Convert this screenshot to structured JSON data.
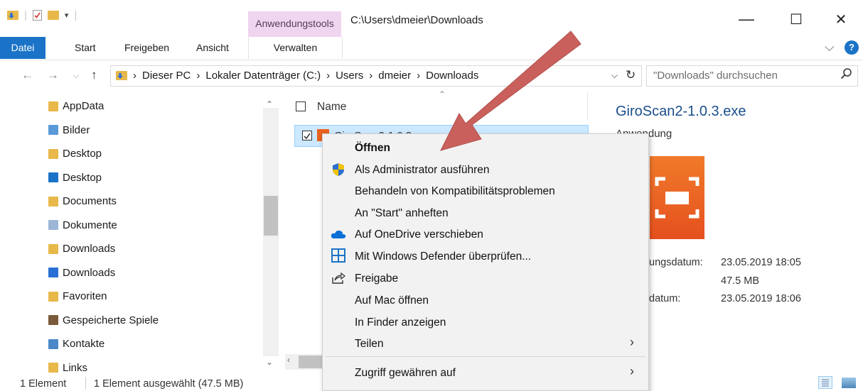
{
  "window": {
    "context_tab_label": "Anwendungstools",
    "path_title": "C:\\Users\\dmeier\\Downloads",
    "minimize": "—",
    "maximize": "☐",
    "close": "✕"
  },
  "ribbon": {
    "tabs": [
      "Datei",
      "Start",
      "Freigeben",
      "Ansicht",
      "Verwalten"
    ],
    "expand": "⌵",
    "help": "?"
  },
  "navigation": {
    "breadcrumbs": [
      "Dieser PC",
      "Lokaler Datenträger (C:)",
      "Users",
      "dmeier",
      "Downloads"
    ],
    "search_placeholder": "\"Downloads\" durchsuchen"
  },
  "tree": [
    {
      "label": "AppData",
      "icon": "folder-icon",
      "color": "#e8b84a"
    },
    {
      "label": "Bilder",
      "icon": "pictures-folder-icon",
      "color": "#5a9ad8"
    },
    {
      "label": "Desktop",
      "icon": "folder-icon",
      "color": "#e8b84a"
    },
    {
      "label": "Desktop",
      "icon": "desktop-folder-icon",
      "color": "#1a73c7"
    },
    {
      "label": "Documents",
      "icon": "folder-icon",
      "color": "#e8b84a"
    },
    {
      "label": "Dokumente",
      "icon": "documents-folder-icon",
      "color": "#9cb6d8"
    },
    {
      "label": "Downloads",
      "icon": "folder-icon",
      "color": "#e8b84a"
    },
    {
      "label": "Downloads",
      "icon": "downloads-folder-icon",
      "color": "#2a6fd6"
    },
    {
      "label": "Favoriten",
      "icon": "favorites-folder-icon",
      "color": "#e8b84a"
    },
    {
      "label": "Gespeicherte Spiele",
      "icon": "saved-games-folder-icon",
      "color": "#7a5a3a"
    },
    {
      "label": "Kontakte",
      "icon": "contacts-folder-icon",
      "color": "#4a88c8"
    },
    {
      "label": "Links",
      "icon": "links-folder-icon",
      "color": "#e8b84a"
    }
  ],
  "file_list": {
    "column_name": "Name",
    "selected_file_visible_text": "GiroScan2-1.0.3"
  },
  "preview": {
    "title": "GiroScan2-1.0.3.exe",
    "subtitle": "Anwendung",
    "meta": [
      {
        "label": "ungsdatum:",
        "value": "23.05.2019 18:05"
      },
      {
        "label": "",
        "value": "47.5 MB"
      },
      {
        "label": "datum:",
        "value": "23.05.2019 18:06"
      }
    ]
  },
  "context_menu": {
    "items": [
      {
        "label": "Öffnen",
        "bold": true,
        "icon": ""
      },
      {
        "label": "Als Administrator ausführen",
        "icon": "uac-shield-icon"
      },
      {
        "label": "Behandeln von Kompatibilitätsproblemen",
        "icon": ""
      },
      {
        "label": "An \"Start\" anheften",
        "icon": ""
      },
      {
        "label": "Auf OneDrive verschieben",
        "icon": "onedrive-cloud-icon"
      },
      {
        "label": "Mit Windows Defender überprüfen...",
        "icon": "windows-defender-icon"
      },
      {
        "label": "Freigabe",
        "icon": "share-icon"
      },
      {
        "label": "Auf Mac öffnen",
        "icon": ""
      },
      {
        "label": "In Finder anzeigen",
        "icon": ""
      },
      {
        "label": "Teilen",
        "icon": "",
        "submenu": true
      },
      {
        "label": "Zugriff gewähren auf",
        "icon": "",
        "submenu": true
      }
    ]
  },
  "status": {
    "count": "1 Element",
    "selection": "1 Element ausgewählt (47.5 MB)"
  },
  "colors": {
    "accent": "#1a73c7",
    "context_tab": "#f0d5ef",
    "selection": "#cce8ff",
    "annotation_arrow": "#c9605c"
  }
}
